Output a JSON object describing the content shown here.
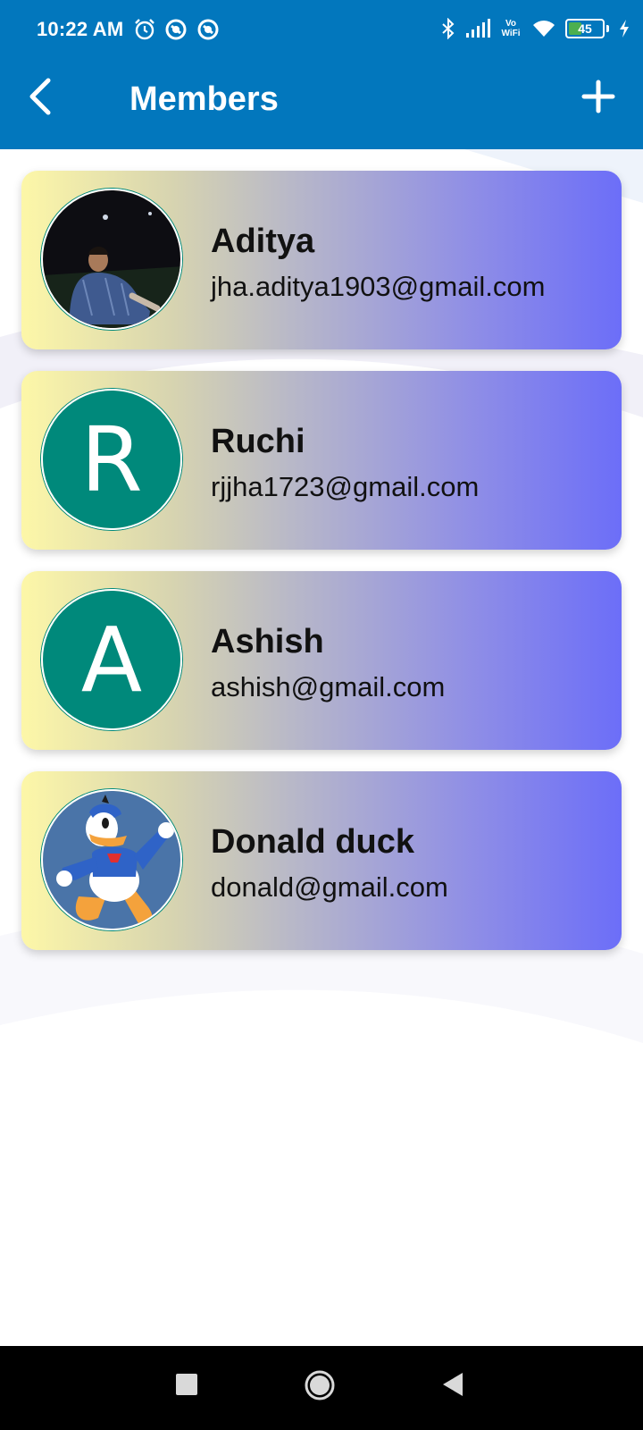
{
  "status_bar": {
    "time": "10:22 AM",
    "left_icons": [
      "alarm-icon",
      "data-saver-icon",
      "data-saver-icon"
    ],
    "right_icons": [
      "bluetooth-icon",
      "signal-icon",
      "vowifi-icon",
      "wifi-icon",
      "battery-icon",
      "charging-icon"
    ],
    "vowifi_top": "Vo",
    "vowifi_bottom": "WiFi",
    "battery_level": "45"
  },
  "toolbar": {
    "title": "Members",
    "back_icon": "back-arrow-icon",
    "add_icon": "plus-icon"
  },
  "members": [
    {
      "name": "Aditya",
      "email": "jha.aditya1903@gmail.com",
      "avatar_type": "photo"
    },
    {
      "name": "Ruchi",
      "email": "rjjha1723@gmail.com",
      "avatar_type": "letter",
      "avatar_letter": "R"
    },
    {
      "name": "Ashish",
      "email": "ashish@gmail.com",
      "avatar_type": "letter",
      "avatar_letter": "A"
    },
    {
      "name": "Donald duck",
      "email": "donald@gmail.com",
      "avatar_type": "photo"
    }
  ],
  "nav_bar": {
    "buttons": [
      "recents-icon",
      "home-icon",
      "back-icon"
    ]
  },
  "colors": {
    "app_bar": "#0277bd",
    "avatar_bg": "#00897b",
    "card_gradient_start": "#fdf7a8",
    "card_gradient_end": "#6c6ef8"
  }
}
